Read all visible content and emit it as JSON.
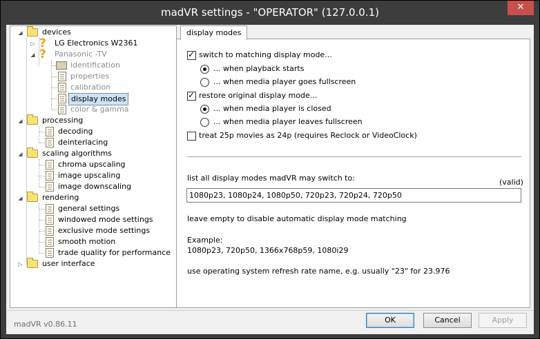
{
  "window": {
    "title": "madVR settings - \"OPERATOR\" (127.0.0.1)",
    "close_glyph": "✕"
  },
  "tree": {
    "devices": "devices",
    "lg": "LG Electronics W2361",
    "panasonic": "Panasonic -TV",
    "identification": "identification",
    "properties": "properties",
    "calibration": "calibration",
    "display_modes": "display modes",
    "color_gamma": "color & gamma",
    "processing": "processing",
    "decoding": "decoding",
    "deinterlacing": "deinterlacing",
    "scaling": "scaling algorithms",
    "chroma": "chroma upscaling",
    "image_up": "image upscaling",
    "image_down": "image downscaling",
    "rendering": "rendering",
    "general": "general settings",
    "windowed": "windowed mode settings",
    "exclusive": "exclusive mode settings",
    "smooth": "smooth motion",
    "trade": "trade quality for performance",
    "user_interface": "user interface"
  },
  "tab": {
    "label": "display modes"
  },
  "panel": {
    "switch_matching": "switch to matching display mode...",
    "when_playback_starts": "... when playback starts",
    "when_fullscreen": "... when media player goes fullscreen",
    "restore_original": "restore original display mode...",
    "when_closed": "... when media player is closed",
    "when_leaves_fullscreen": "... when media player leaves fullscreen",
    "treat_25p": "treat 25p movies as 24p  (requires Reclock or VideoClock)",
    "list_label": "list all display modes madVR may switch to:",
    "valid": "(valid)",
    "modes_value": "1080p23, 1080p24, 1080p50, 720p23, 720p24, 720p50",
    "leave_empty": "leave empty to disable automatic display mode matching",
    "example_label": "Example:",
    "example_value": "1080p23, 720p50, 1366x768p59, 1080i29",
    "os_hint": "use operating system refresh rate name, e.g. usually \"23\" for 23.976"
  },
  "footer": {
    "version": "madVR v0.86.11",
    "ok": "OK",
    "cancel": "Cancel",
    "apply": "Apply"
  },
  "colors": {
    "titlebar": "#3d3d3d",
    "close": "#c7504c",
    "selection": "#cce4f7",
    "folder": "#f7e27a"
  }
}
